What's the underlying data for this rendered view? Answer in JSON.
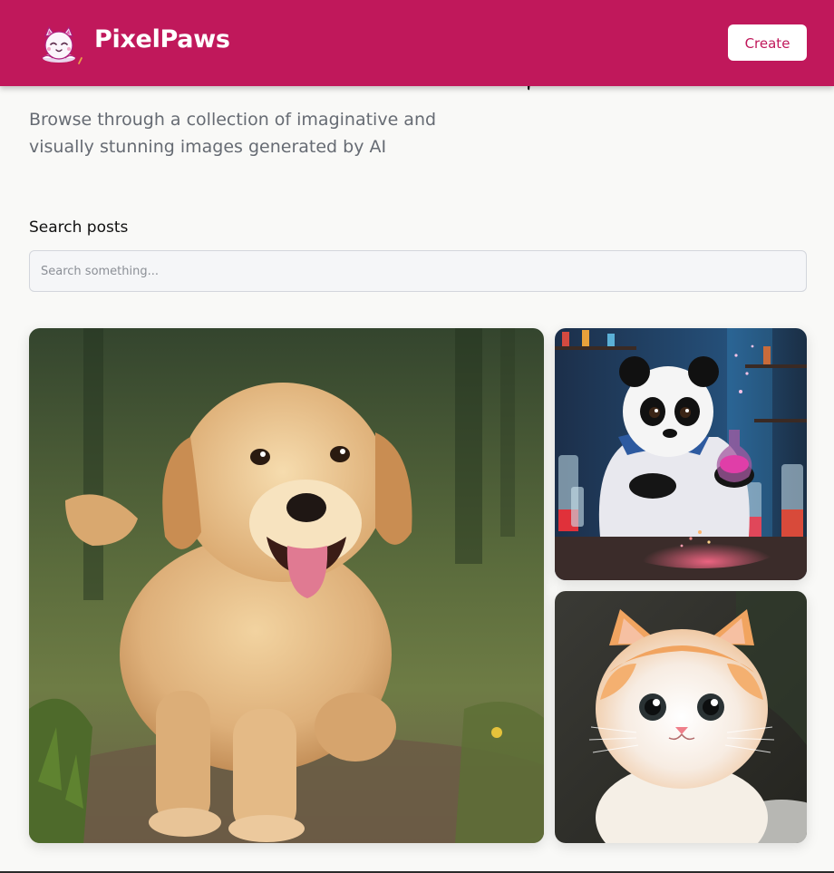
{
  "header": {
    "brand_name": "PixelPaws",
    "create_label": "Create",
    "background_color": "#c0185b",
    "logo_icon": "cat-face-icon"
  },
  "hero": {
    "subtitle": "Browse through a collection of imaginative and visually stunning images generated by AI"
  },
  "search": {
    "label": "Search posts",
    "placeholder": "Search something...",
    "value": ""
  },
  "gallery": {
    "posts": [
      {
        "subject": "golden-retriever-puppy"
      },
      {
        "subject": "panda-scientist"
      },
      {
        "subject": "orange-white-kitten"
      }
    ]
  }
}
